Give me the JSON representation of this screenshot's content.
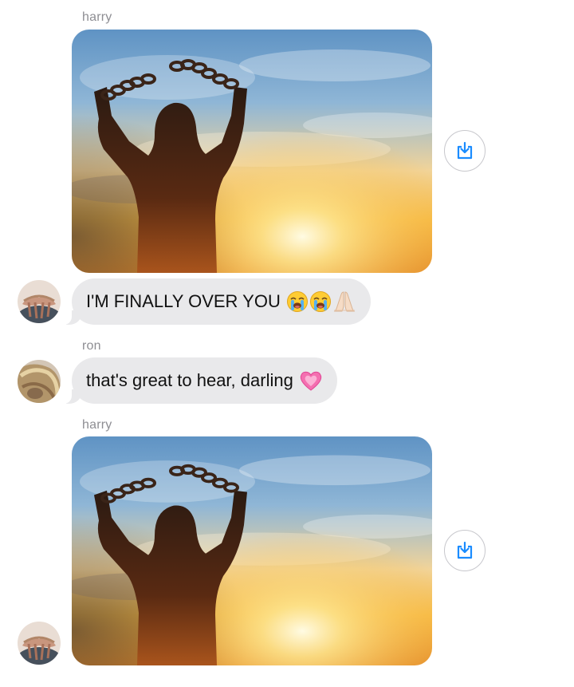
{
  "messages": [
    {
      "type": "label",
      "sender": "harry"
    },
    {
      "type": "image",
      "alt": "silhouette breaking chains at sunset"
    },
    {
      "type": "text",
      "sender": "harry",
      "text": "I'M FINALLY OVER YOU",
      "emojis": [
        "loudly-crying-face",
        "loudly-crying-face",
        "folded-hands"
      ]
    },
    {
      "type": "label",
      "sender": "ron"
    },
    {
      "type": "text",
      "sender": "ron",
      "text": "that's great to hear, darling",
      "emojis": [
        "growing-heart"
      ]
    },
    {
      "type": "label",
      "sender": "harry"
    },
    {
      "type": "image",
      "alt": "silhouette breaking chains at sunset"
    }
  ],
  "icons": {
    "save": "download-to-device-icon"
  },
  "colors": {
    "bubble_bg": "#e9e9eb",
    "sender_label": "#8e8e93",
    "accent": "#1a8cff"
  }
}
